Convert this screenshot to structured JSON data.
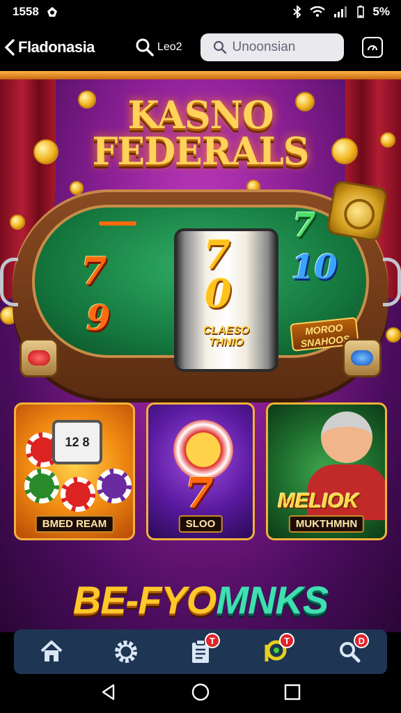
{
  "status": {
    "time": "1558",
    "battery": "5%"
  },
  "topbar": {
    "back_label": "Fladonasia",
    "search_btn_label": "Leo2",
    "search_placeholder": "Unoonsian"
  },
  "hero": {
    "logo_line1": "KASNO",
    "logo_line2": "FEDERALS"
  },
  "reels": {
    "left": [
      "7",
      "9"
    ],
    "center": [
      "7",
      "0"
    ],
    "right": [
      "7",
      "10"
    ],
    "center_label_1": "CLAESO",
    "center_label_2": "THNIO",
    "plate_line1": "MOROO",
    "plate_line2": "SNAHOOS"
  },
  "cards": [
    {
      "label": "BMED REAM",
      "reel": "12 8"
    },
    {
      "label": "SLOO",
      "symbol": "7"
    },
    {
      "label": "MUKTHMHN",
      "title": "MELIOK"
    }
  ],
  "banner": {
    "text_a": "BE-FYO",
    "text_b": "MNKS"
  },
  "bottom_nav": {
    "items": [
      {
        "icon": "home-icon",
        "badge": ""
      },
      {
        "icon": "gear-icon",
        "badge": ""
      },
      {
        "icon": "clipboard-icon",
        "badge": "T"
      },
      {
        "icon": "p-coin-icon",
        "badge": "T"
      },
      {
        "icon": "search-icon",
        "badge": "D"
      }
    ]
  },
  "colors": {
    "accent": "#ffc82a",
    "nav_bg": "#1e3553",
    "badge": "#e0242a"
  }
}
